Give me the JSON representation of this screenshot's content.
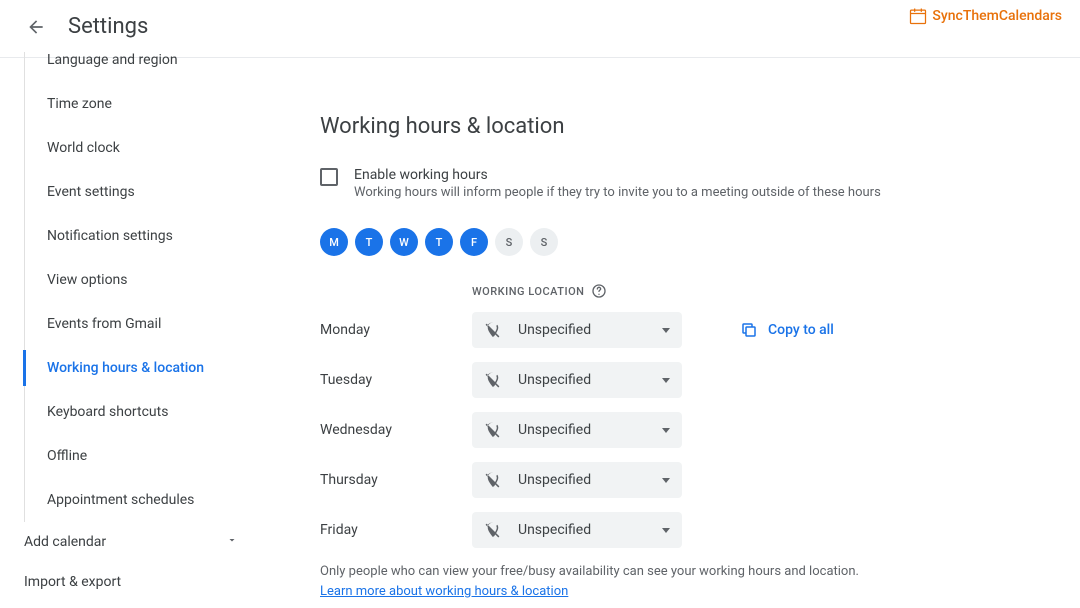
{
  "brand": "SyncThemCalendars",
  "header": {
    "title": "Settings"
  },
  "sidebar": {
    "items": [
      {
        "label": "Language and region",
        "active": false,
        "cut": true
      },
      {
        "label": "Time zone",
        "active": false
      },
      {
        "label": "World clock",
        "active": false
      },
      {
        "label": "Event settings",
        "active": false
      },
      {
        "label": "Notification settings",
        "active": false
      },
      {
        "label": "View options",
        "active": false
      },
      {
        "label": "Events from Gmail",
        "active": false
      },
      {
        "label": "Working hours & location",
        "active": true
      },
      {
        "label": "Keyboard shortcuts",
        "active": false
      },
      {
        "label": "Offline",
        "active": false
      },
      {
        "label": "Appointment schedules",
        "active": false
      }
    ],
    "extra": [
      {
        "label": "Add calendar",
        "expandable": true
      },
      {
        "label": "Import & export",
        "expandable": false
      }
    ]
  },
  "main": {
    "section_title": "Working hours & location",
    "enable": {
      "label": "Enable working hours",
      "desc": "Working hours will inform people if they try to invite you to a meeting outside of these hours",
      "checked": false
    },
    "days": [
      {
        "letter": "M",
        "on": true
      },
      {
        "letter": "T",
        "on": true
      },
      {
        "letter": "W",
        "on": true
      },
      {
        "letter": "T",
        "on": true
      },
      {
        "letter": "F",
        "on": true
      },
      {
        "letter": "S",
        "on": false
      },
      {
        "letter": "S",
        "on": false
      }
    ],
    "working_location_header": "WORKING LOCATION",
    "rows": [
      {
        "day": "Monday",
        "value": "Unspecified"
      },
      {
        "day": "Tuesday",
        "value": "Unspecified"
      },
      {
        "day": "Wednesday",
        "value": "Unspecified"
      },
      {
        "day": "Thursday",
        "value": "Unspecified"
      },
      {
        "day": "Friday",
        "value": "Unspecified"
      }
    ],
    "copy_all": "Copy to all",
    "footnote_text": "Only people who can view your free/busy availability can see your working hours and location.",
    "footnote_link": "Learn more about working hours & location"
  }
}
